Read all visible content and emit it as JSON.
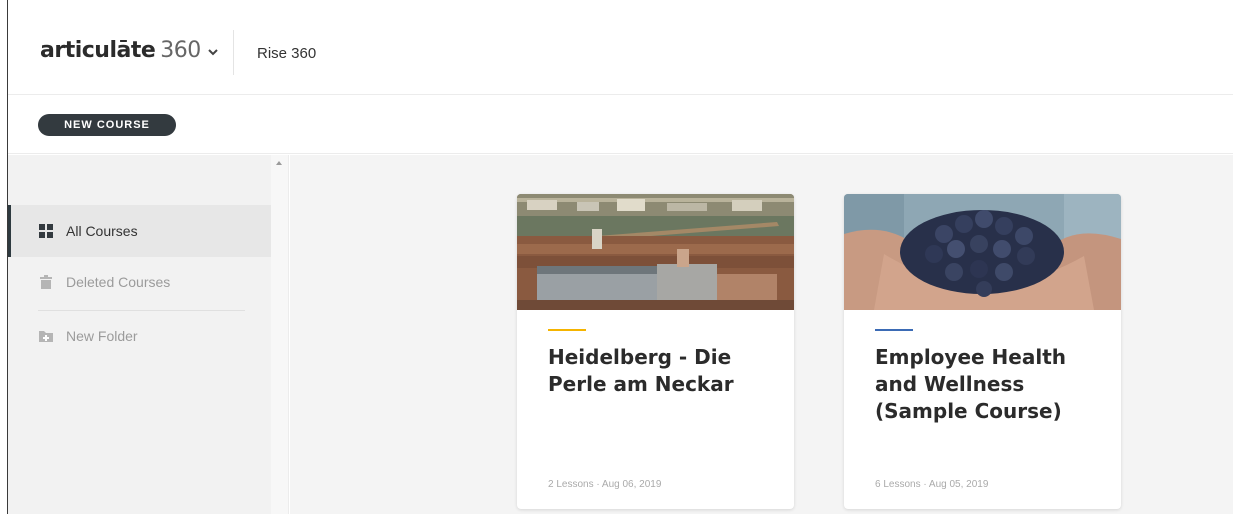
{
  "header": {
    "brand_word": "articulāte",
    "brand_number": "360",
    "product": "Rise 360"
  },
  "toolbar": {
    "new_course_label": "NEW COURSE"
  },
  "sidebar": {
    "items": [
      {
        "label": "All Courses",
        "icon": "grid-icon",
        "active": true
      },
      {
        "label": "Deleted Courses",
        "icon": "trash-icon",
        "active": false
      },
      {
        "label": "New Folder",
        "icon": "add-folder-icon",
        "active": false
      }
    ]
  },
  "courses": [
    {
      "title": "Heidelberg - Die Perle am Neckar",
      "meta": "2 Lessons · Aug 06, 2019",
      "accent": "#f5b400",
      "image": "heidelberg-city-photo"
    },
    {
      "title": "Employee Health and Wellness (Sample Course)",
      "meta": "6 Lessons · Aug 05, 2019",
      "accent": "#3b6bb5",
      "image": "grapes-in-hands-photo"
    }
  ],
  "colors": {
    "button_bg": "#333a3f",
    "sidebar_bg": "#f2f2f2",
    "main_bg": "#f4f4f4"
  }
}
